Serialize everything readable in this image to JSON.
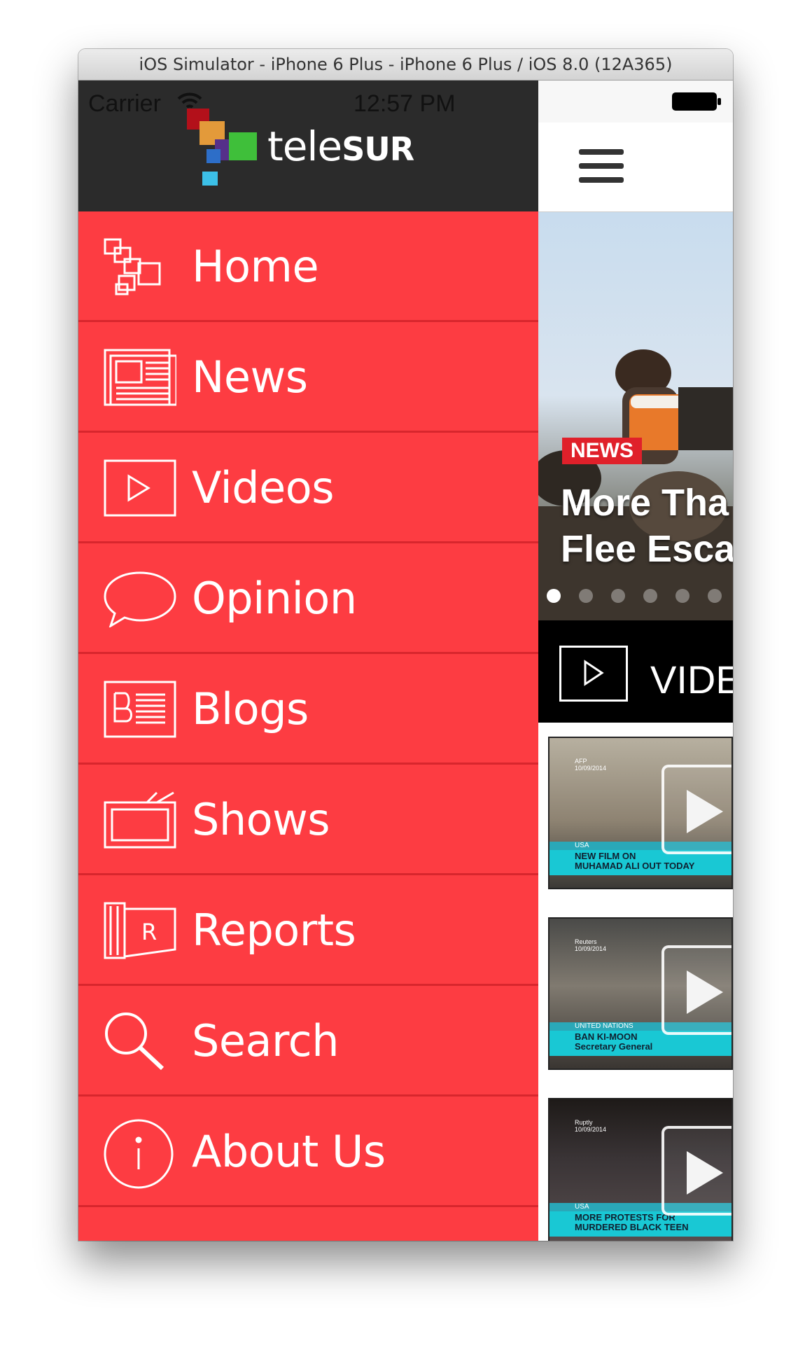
{
  "window": {
    "title": "iOS Simulator - iPhone 6 Plus - iPhone 6 Plus / iOS 8.0 (12A365)"
  },
  "status_bar": {
    "carrier": "Carrier",
    "time": "12:57 PM"
  },
  "logo": {
    "light": "tele",
    "bold": "SUR"
  },
  "menu": {
    "items": [
      {
        "label": "Home",
        "icon": "home-blocks-icon"
      },
      {
        "label": "News",
        "icon": "newspaper-icon"
      },
      {
        "label": "Videos",
        "icon": "play-box-icon"
      },
      {
        "label": "Opinion",
        "icon": "speech-bubble-icon"
      },
      {
        "label": "Blogs",
        "icon": "blog-icon"
      },
      {
        "label": "Shows",
        "icon": "tv-icon"
      },
      {
        "label": "Reports",
        "icon": "reports-icon"
      },
      {
        "label": "Search",
        "icon": "search-icon"
      },
      {
        "label": "About Us",
        "icon": "info-icon"
      }
    ]
  },
  "content": {
    "hero": {
      "tag": "NEWS",
      "title": "More Tha\nFlee Esca",
      "dots_count": 6,
      "active_dot": 0
    },
    "videos_header": "VIDE",
    "thumbs": [
      {
        "source": "AFP\n10/09/2014",
        "location": "USA",
        "caption": "NEW FILM ON\nMUHAMAD ALI OUT TODAY"
      },
      {
        "source": "Reuters\n10/09/2014",
        "location": "UNITED NATIONS",
        "caption": "BAN KI-MOON\nSecretary General"
      },
      {
        "source": "Ruptly\n10/09/2014",
        "location": "USA",
        "caption": "MORE PROTESTS FOR\nMURDERED BLACK TEEN"
      }
    ]
  },
  "colors": {
    "menu_bg": "#fd3c42",
    "menu_divider": "#d8262d",
    "header_bg": "#2b2b2b",
    "news_tag": "#e0202a",
    "ticker": "#19c8d4"
  }
}
